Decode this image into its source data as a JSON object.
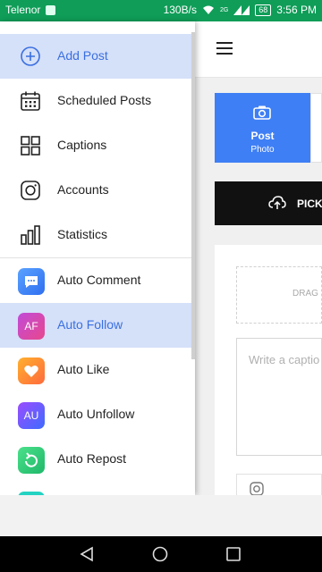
{
  "status_bar": {
    "carrier": "Telenor",
    "speed": "130B/s",
    "network": "2G",
    "battery": "68",
    "time": "3:56 PM"
  },
  "colors": {
    "status_green": "#0f9d58",
    "selected_bg": "#d5e0f9",
    "accent_blue": "#3a6fe0",
    "post_tile": "#3f7ff5"
  },
  "drawer": {
    "items": [
      {
        "label": "Add Post",
        "icon": "add-circle-icon",
        "selected": true
      },
      {
        "label": "Scheduled Posts",
        "icon": "calendar-icon"
      },
      {
        "label": "Captions",
        "icon": "grid-icon"
      },
      {
        "label": "Accounts",
        "icon": "instagram-icon"
      },
      {
        "label": "Statistics",
        "icon": "bar-chart-icon"
      },
      {
        "label": "Auto Comment",
        "icon": "comment-app-icon"
      },
      {
        "label": "Auto Follow",
        "icon": "af-app-icon",
        "badge": "AF",
        "selected": true
      },
      {
        "label": "Auto Like",
        "icon": "heart-app-icon"
      },
      {
        "label": "Auto Unfollow",
        "icon": "au-app-icon",
        "badge": "AU"
      },
      {
        "label": "Auto Repost",
        "icon": "repost-app-icon"
      }
    ]
  },
  "main": {
    "post_tile": {
      "title": "Post",
      "subtitle": "Photo"
    },
    "pick_label": "PICK",
    "drag_label": "DRAG",
    "caption_placeholder": "Write a captio"
  }
}
